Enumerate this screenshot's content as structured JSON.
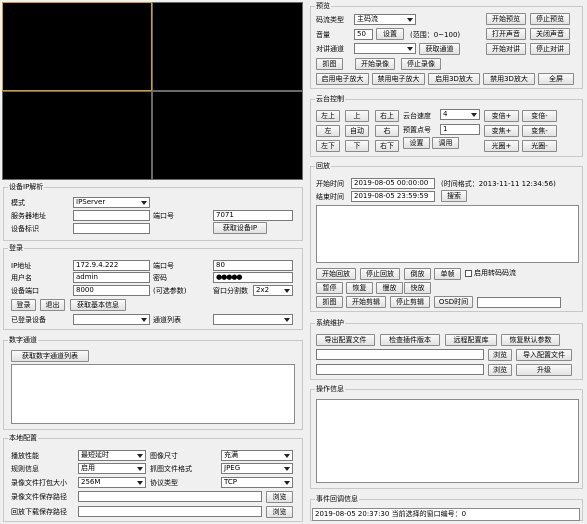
{
  "video": {
    "panes": [
      "pane-1",
      "pane-2",
      "pane-3",
      "pane-4"
    ],
    "selected": 0,
    "accent": "#d8a000"
  },
  "device_ip": {
    "title": "设备IP解析",
    "mode_label": "模式",
    "mode_value": "IPServer",
    "server_label": "服务器地址",
    "port_label": "端口号",
    "port_value": "7071",
    "devid_label": "设备标识",
    "get_ip_btn": "获取设备IP"
  },
  "login": {
    "title": "登录",
    "ip_label": "IP地址",
    "ip_value": "172.9.4.222",
    "port_label": "端口号",
    "port_value": "80",
    "user_label": "用户名",
    "user_value": "admin",
    "pwd_label": "密码",
    "pwd_value": "●●●●●",
    "devport_label": "设备端口",
    "devport_value": "8000",
    "optional_label": "(可选参数)",
    "split_label": "窗口分割数",
    "split_value": "2x2",
    "login_btn": "登录",
    "logout_btn": "退出",
    "getinfo_btn": "获取基本信息",
    "logged_label": "已登录设备",
    "channel_label": "通道列表"
  },
  "digital": {
    "title": "数字通道",
    "get_btn": "获取数字通道列表"
  },
  "local": {
    "title": "本地配置",
    "perf_label": "播放性能",
    "perf_value": "最短延时",
    "size_label": "图像尺寸",
    "size_value": "充满",
    "rule_label": "规则信息",
    "rule_value": "启用",
    "capfmt_label": "抓图文件格式",
    "capfmt_value": "JPEG",
    "pkg_label": "录像文件打包大小",
    "pkg_value": "256M",
    "proto_label": "协议类型",
    "proto_value": "TCP",
    "recpath_label": "录像文件保存路径",
    "dlpath_label": "回放下载保存路径",
    "browse_btn": "浏览"
  },
  "preview": {
    "title": "预览",
    "stream_label": "码流类型",
    "stream_value": "主码流",
    "start_btn": "开始预览",
    "stop_btn": "停止预览",
    "vol_label": "音量",
    "vol_value": "50",
    "set_btn": "设置",
    "range_label": "(范围：0~100)",
    "open_sound_btn": "打开声音",
    "close_sound_btn": "关闭声音",
    "talk_label": "对讲通道",
    "get_channel_btn": "获取通道",
    "start_talk_btn": "开始对讲",
    "stop_talk_btn": "停止对讲",
    "capture_btn": "抓图",
    "start_rec_btn": "开始录像",
    "stop_rec_btn": "停止录像",
    "ezoom_on_btn": "启用电子放大",
    "ezoom_off_btn": "禁用电子放大",
    "zoom3d_on_btn": "启用3D放大",
    "zoom3d_off_btn": "禁用3D放大",
    "fullscreen_btn": "全屏"
  },
  "ptz": {
    "title": "云台控制",
    "up_left": "左上",
    "up": "上",
    "up_right": "右上",
    "speed_label": "云台速度",
    "speed_value": "4",
    "zoom_in": "变倍+",
    "zoom_out": "变倍-",
    "left": "左",
    "auto": "自动",
    "right": "右",
    "preset_label": "预置点号",
    "preset_value": "1",
    "focus_in": "变焦+",
    "focus_out": "变焦-",
    "down_left": "左下",
    "down": "下",
    "down_right": "右下",
    "set_btn": "设置",
    "call_btn": "调用",
    "iris_in": "光圈+",
    "iris_out": "光圈-"
  },
  "playback": {
    "title": "回放",
    "start_label": "开始时间",
    "start_value": "2019-08-05 00:00:00",
    "format_label": "(时间格式：2013-11-11 12:34:56)",
    "end_label": "结束时间",
    "end_value": "2019-08-05 23:59:59",
    "search_btn": "搜索",
    "start_play_btn": "开始回放",
    "stop_play_btn": "停止回放",
    "reverse_btn": "倒放",
    "frame_btn": "单帧",
    "transcode_label": "启用转码码流",
    "pause_btn": "暂停",
    "resume_btn": "恢复",
    "slow_btn": "慢放",
    "fast_btn": "快放",
    "capture_btn": "抓图",
    "start_clip_btn": "开始剪辑",
    "stop_clip_btn": "停止剪辑",
    "osd_btn": "OSD时间"
  },
  "maintenance": {
    "title": "系统维护",
    "export_btn": "导出配置文件",
    "check_plugin_btn": "检查插件版本",
    "remote_cfg_btn": "远程配置库",
    "restore_btn": "恢复默认参数",
    "browse_btn": "浏览",
    "import_btn": "导入配置文件",
    "upgrade_btn": "升级"
  },
  "operation": {
    "title": "操作信息"
  },
  "events": {
    "title": "事件回调信息",
    "message": "2019-08-05 20:37:30 当前选择的窗口编号：0"
  }
}
